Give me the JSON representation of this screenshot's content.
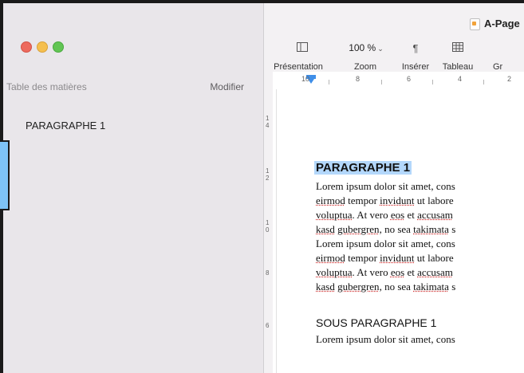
{
  "sidebar": {
    "toc_title": "Table des matières",
    "modify_label": "Modifier",
    "items": [
      {
        "label": "PARAGRAPHE 1"
      }
    ]
  },
  "toolbar": {
    "document_title": "A-Page",
    "zoom_value": "100 %",
    "tools": [
      {
        "label": "Présentation",
        "icon": "sidebar-icon"
      },
      {
        "label": "Zoom",
        "icon": "chevron-down-icon"
      },
      {
        "label": "Insérer",
        "icon": "paragraph-icon"
      },
      {
        "label": "Tableau",
        "icon": "table-icon"
      },
      {
        "label": "Gr",
        "icon": ""
      }
    ]
  },
  "ruler": {
    "horizontal_numbers": [
      "10",
      "8",
      "6",
      "4",
      "2"
    ],
    "vertical_numbers": [
      "1\n4",
      "1\n2",
      "1\n0",
      "8",
      "6"
    ]
  },
  "document": {
    "heading": "PARAGRAPHE 1",
    "lines": [
      "Lorem ipsum dolor sit amet, cons",
      "eirmod tempor invidunt ut labore",
      "voluptua. At vero eos et accusam",
      "kasd gubergren, no sea takimata s",
      "Lorem ipsum dolor sit amet, cons",
      "eirmod tempor invidunt ut labore",
      "voluptua. At vero eos et accusam",
      "kasd gubergren, no sea takimata s"
    ],
    "subheading": "SOUS PARAGRAPHE 1",
    "sub_line": "Lorem ipsum dolor sit amet, cons"
  },
  "colors": {
    "highlight": "#b3d7fb",
    "ruler_tab": "#3f8ee8",
    "sidebar_bg": "#e9e6ea"
  }
}
